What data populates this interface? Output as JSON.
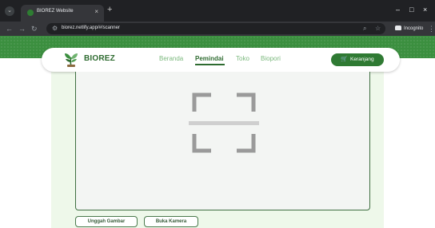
{
  "browser": {
    "tab_title": "BIOREZ Website",
    "tab_close": "×",
    "new_tab": "+",
    "url": "biorez.netlify.app/#/scanner",
    "incognito_label": "Incognito",
    "window_controls": [
      "–",
      "□",
      "×"
    ],
    "icons": [
      "tab-search-icon",
      "back-icon",
      "forward-icon",
      "reload-icon",
      "tune-icon",
      "search-zoom-icon",
      "bookmark-star-icon",
      "incognito-icon",
      "kebab-menu-icon"
    ]
  },
  "site": {
    "brand": "BIOREZ",
    "nav": {
      "beranda": "Beranda",
      "pemindai": "Pemindai",
      "toko": "Toko",
      "biopori": "Biopori"
    },
    "active_nav": "Pemindai",
    "cart_label": "Keranjang",
    "cart_icon": "cart-icon",
    "scan_icon": "scan-frame-icon",
    "upload_button": "Unggah Gambar",
    "camera_button": "Buka Kamera"
  },
  "colors": {
    "brand_green": "#2e6b30",
    "header_green": "#3b8f3f",
    "light_green": "#eef8ea",
    "inactive_nav": "#7cb97e"
  }
}
